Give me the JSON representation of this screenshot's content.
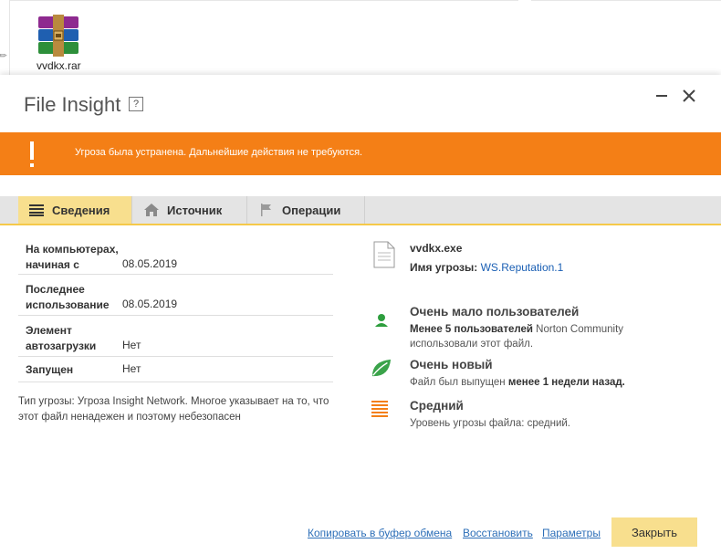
{
  "desktop": {
    "file_label": "vvdkx.rar",
    "file_icon": "winrar-archive-icon"
  },
  "dialog": {
    "title": "File Insight",
    "help_label": "?",
    "minimize_icon": "minimize-icon",
    "close_icon": "close-icon"
  },
  "banner": {
    "color": "#f47f16",
    "icon": "exclamation-icon",
    "message": "Угроза была устранена. Дальнейшие действия не требуются."
  },
  "tabs": [
    {
      "label": "Сведения",
      "icon": "list-icon",
      "active": true
    },
    {
      "label": "Источник",
      "icon": "home-icon",
      "active": false
    },
    {
      "label": "Операции",
      "icon": "flag-icon",
      "active": false
    }
  ],
  "details": {
    "rows": [
      {
        "key": "На компьютерах, начиная с",
        "value": "08.05.2019"
      },
      {
        "key": "Последнее использование",
        "value": "08.05.2019"
      },
      {
        "key": "Элемент автозагрузки",
        "value": "Нет"
      },
      {
        "key": "Запущен",
        "value": "Нет"
      }
    ],
    "threat_type_text": "Тип угрозы: Угроза Insight Network. Многое указывает на то, что этот файл ненадежен и поэтому небезопасен"
  },
  "file": {
    "name": "vvdkx.exe",
    "threat_name_label": "Имя угрозы:",
    "threat_name_value": "WS.Reputation.1"
  },
  "features": [
    {
      "icon": "user-icon",
      "heading": "Очень мало пользователей",
      "bold": "Менее 5 пользователей",
      "text_a": " Norton Community",
      "text_b": "использовали этот файл."
    },
    {
      "icon": "leaf-icon",
      "heading": "Очень новый",
      "text_a": "Файл был выпущен ",
      "bold": "менее 1 недели назад."
    },
    {
      "icon": "threat-level-icon",
      "heading": "Средний",
      "text_a": "Уровень угрозы файла: средний."
    }
  ],
  "footer": {
    "copy_link": "Копировать в буфер обмена",
    "restore_link": "Восстановить",
    "settings_link": "Параметры",
    "close_button": "Закрыть"
  },
  "colors": {
    "accent_yellow": "#f8df8e",
    "link_blue": "#2d6fb8",
    "green": "#2e9e3e",
    "orange": "#f47f16"
  }
}
